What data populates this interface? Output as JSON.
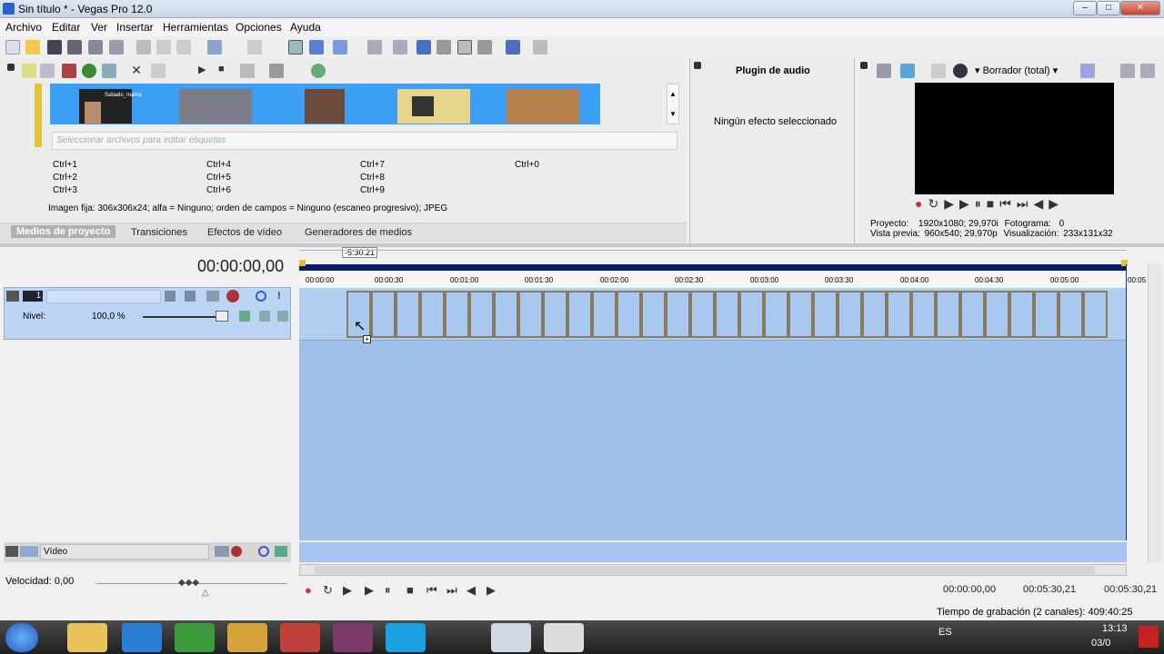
{
  "window": {
    "title": "Sin título * - Vegas Pro 12.0"
  },
  "menu": [
    "Archivo",
    "Editar",
    "Ver",
    "Insertar",
    "Herramientas",
    "Opciones",
    "Ayuda"
  ],
  "media": {
    "tag_placeholder": "Seleccionar archivos para editar etiquetas",
    "shortcuts": [
      "Ctrl+1",
      "Ctrl+2",
      "Ctrl+3",
      "Ctrl+4",
      "Ctrl+5",
      "Ctrl+6",
      "Ctrl+7",
      "Ctrl+8",
      "Ctrl+9",
      "Ctrl+0"
    ],
    "file_info": "Imagen fija: 306x306x24; alfa = Ninguno; orden de campos = Ninguno (escaneo progresivo); JPEG",
    "thumb_caption": "Sabado_mama"
  },
  "tabs": [
    "Medios de proyecto",
    "Transiciones",
    "Efectos de vídeo",
    "Generadores de medios"
  ],
  "plugin": {
    "title": "Plugin de audio",
    "empty": "Ningún efecto seleccionado"
  },
  "preview": {
    "mode": "Borrador (total)",
    "project_label": "Proyecto:",
    "project_value": "1920x1080; 29,970i",
    "frame_label": "Fotograma:",
    "frame_value": "0",
    "preview_label": "Vista previa:",
    "preview_value": "960x540; 29,970p",
    "display_label": "Visualización:",
    "display_value": "233x131x32"
  },
  "timeline": {
    "timecode": "00:00:00,00",
    "marker": "-5:30.21",
    "ruler": [
      "00:00:00",
      "00:00:30",
      "00:01:00",
      "00:01:30",
      "00:02:00",
      "00:02:30",
      "00:03:00",
      "00:03:30",
      "00:04:00",
      "00:04:30",
      "00:05:00",
      "00:05"
    ],
    "track_number": "1",
    "level_label": "Nivel:",
    "level_value": "100,0 %",
    "audio_track": "Vídeo",
    "velocity": "Velocidad: 0,00"
  },
  "transport": {
    "time_start": "00:00:00,00",
    "time_end": "00:05:30,21",
    "time_length": "00:05:30,21",
    "record_time": "Tiempo de grabación (2 canales): 409:40:25"
  },
  "taskbar": {
    "lang": "ES",
    "clock": "13:13",
    "date": "03/0"
  },
  "colors": {
    "selection": "#3d9ef5",
    "timeline": "#9fc0ea",
    "track_head": "#bcd4f4",
    "ruler_band": "#0a1a6a"
  }
}
